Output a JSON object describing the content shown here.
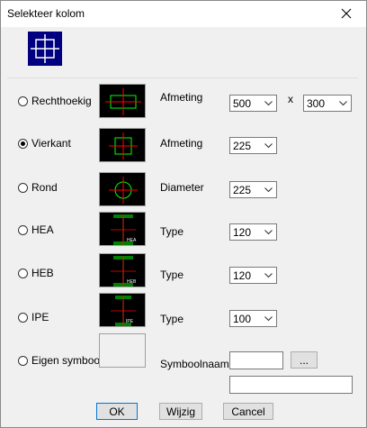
{
  "window": {
    "title": "Selekteer kolom"
  },
  "options": [
    {
      "label": "Rechthoekig",
      "checked": false,
      "field_label": "Afmeting",
      "value": "500",
      "extra_label": "x",
      "extra_value": "300"
    },
    {
      "label": "Vierkant",
      "checked": true,
      "field_label": "Afmeting",
      "value": "225"
    },
    {
      "label": "Rond",
      "checked": false,
      "field_label": "Diameter",
      "value": "225"
    },
    {
      "label": "HEA",
      "checked": false,
      "field_label": "Type",
      "value": "120",
      "preview_tag": "HEA"
    },
    {
      "label": "HEB",
      "checked": false,
      "field_label": "Type",
      "value": "120",
      "preview_tag": "HEB"
    },
    {
      "label": "IPE",
      "checked": false,
      "field_label": "Type",
      "value": "100",
      "preview_tag": "IPE"
    },
    {
      "label": "Eigen symbool",
      "checked": false,
      "field_label": "Symboolnaam",
      "value": "",
      "browse_label": "..."
    }
  ],
  "buttons": {
    "ok": "OK",
    "edit": "Wijzig",
    "cancel": "Cancel"
  },
  "colors": {
    "shape": "#00ff00",
    "axis": "#ff0000",
    "preview_bg": "#000000",
    "icon_bg": "#000080"
  },
  "icons": {
    "dropdown": "chevron-down-icon",
    "close": "close-icon"
  }
}
